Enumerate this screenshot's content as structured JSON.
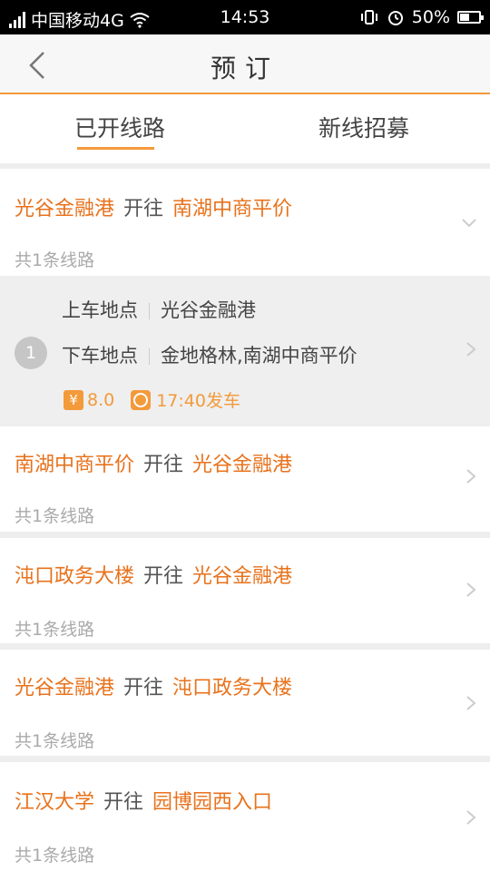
{
  "status": {
    "carrier": "中国移动4G",
    "time": "14:53",
    "battery": "50%",
    "battery_level": 0.5
  },
  "navbar": {
    "title": "预订"
  },
  "tabs": [
    {
      "label": "已开线路",
      "active": true
    },
    {
      "label": "新线招募",
      "active": false
    }
  ],
  "routes": [
    {
      "from": "光谷金融港",
      "to": "南湖中商平价",
      "go": "开往",
      "count": "共1条线路",
      "expanded": true
    },
    {
      "from": "南湖中商平价",
      "to": "光谷金融港",
      "go": "开往",
      "count": "共1条线路"
    },
    {
      "from": "沌口政务大楼",
      "to": "光谷金融港",
      "go": "开往",
      "count": "共1条线路"
    },
    {
      "from": "光谷金融港",
      "to": "沌口政务大楼",
      "go": "开往",
      "count": "共1条线路"
    },
    {
      "from": "江汉大学",
      "to": "园博园西入口",
      "go": "开往",
      "count": "共1条线路"
    }
  ],
  "detail": {
    "index": "1",
    "pickup_label": "上车地点",
    "pickup": "光谷金融港",
    "dropoff_label": "下车地点",
    "dropoff": "金地格林,南湖中商平价",
    "price_icon": "¥",
    "price": "8.0",
    "depart": "17:40发车"
  },
  "colors": {
    "accent": "#e8721c",
    "underline": "#f39a3a"
  }
}
